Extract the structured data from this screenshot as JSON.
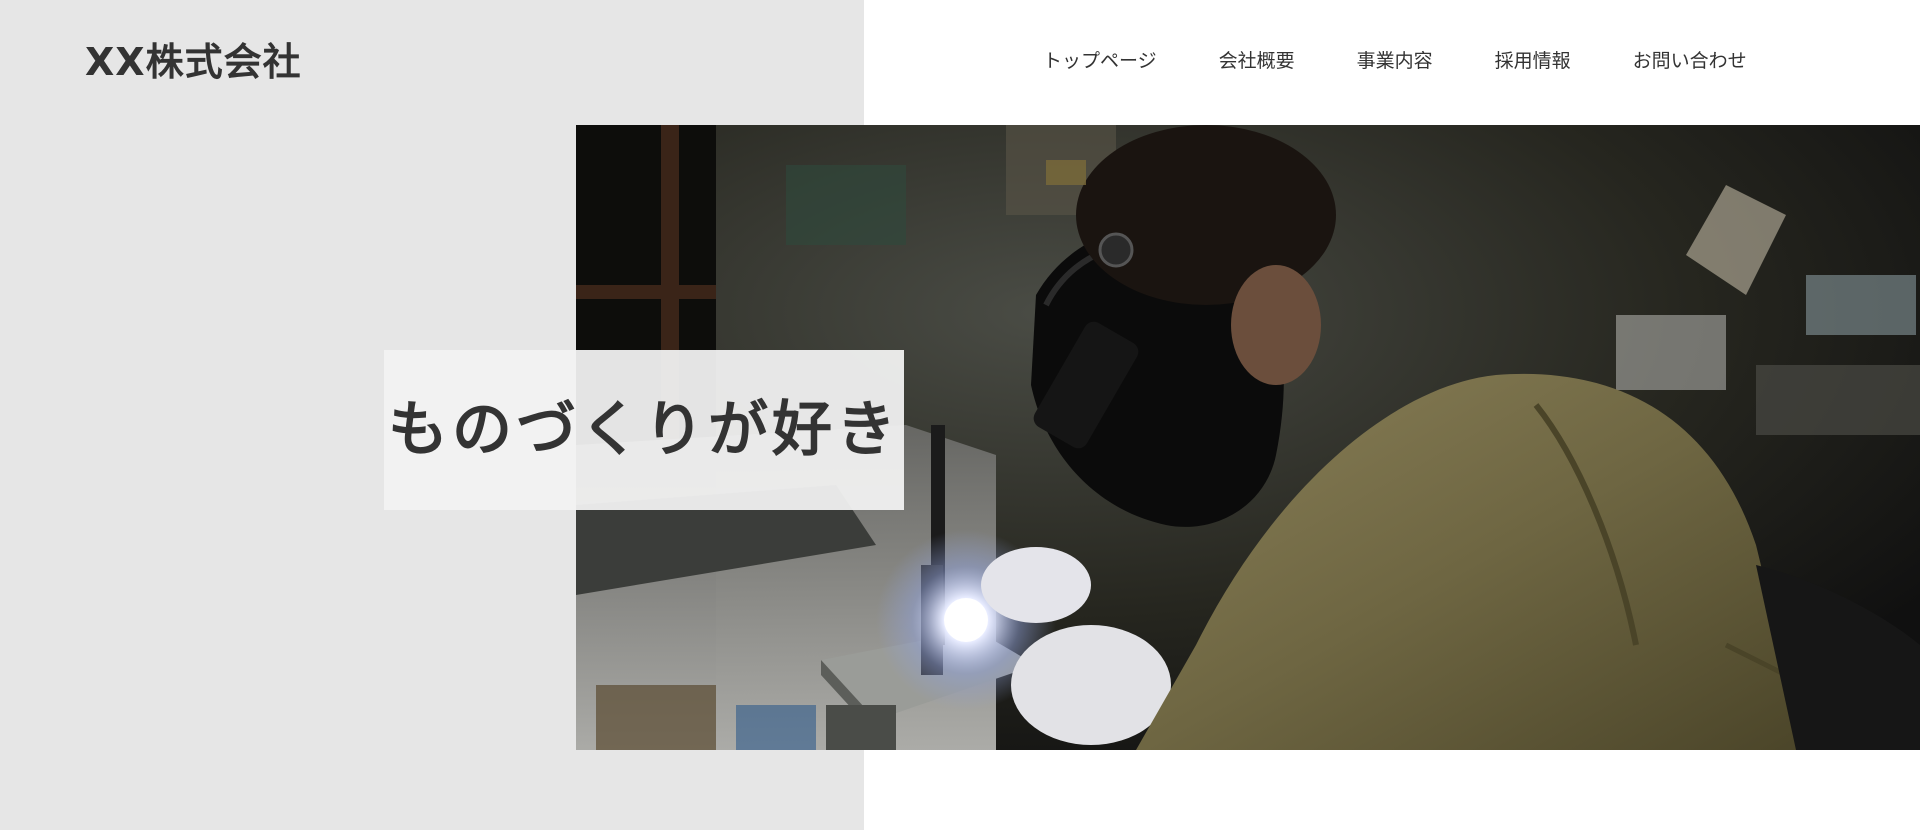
{
  "header": {
    "logo_text": "XX株式会社"
  },
  "nav": {
    "items": [
      {
        "label": "トップページ"
      },
      {
        "label": "会社概要"
      },
      {
        "label": "事業内容"
      },
      {
        "label": "採用情報"
      },
      {
        "label": "お問い合わせ"
      }
    ]
  },
  "hero": {
    "tagline": "ものづくりが好き",
    "photo_subject": "welder-at-work",
    "colors": {
      "left_panel": "#e6e6e6",
      "text": "#333333",
      "tagline_box": "#f2f2f2"
    }
  }
}
